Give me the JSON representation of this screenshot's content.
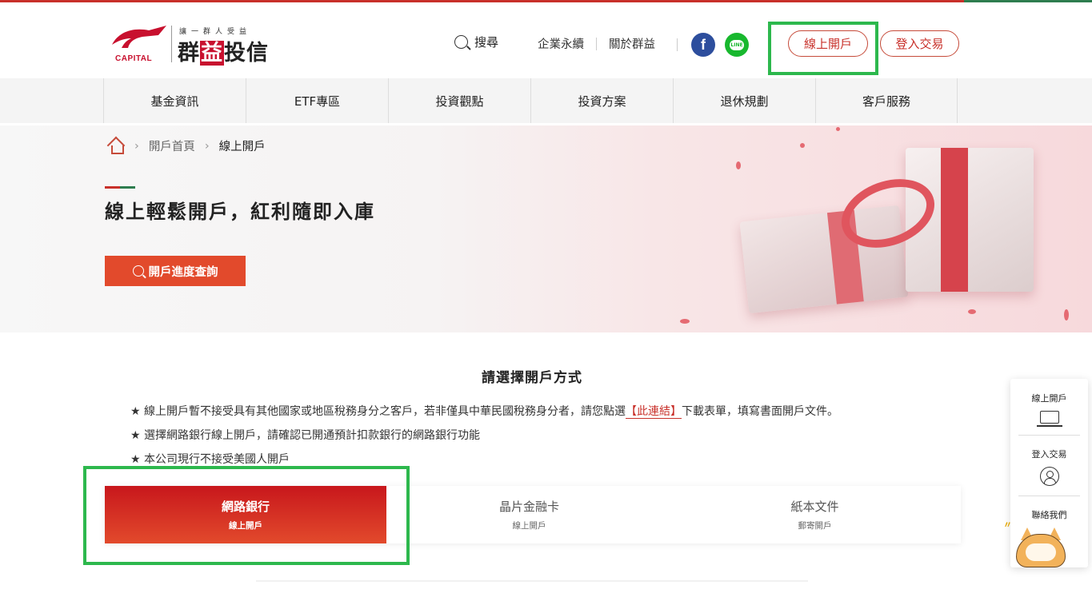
{
  "brand": {
    "logo_text": "CAPITAL",
    "slogan": "讓一群人受益",
    "name_part1": "群",
    "name_part2": "益",
    "name_part3": "投信"
  },
  "header": {
    "search_label": "搜尋",
    "links": [
      "企業永續",
      "關於群益"
    ],
    "facebook_glyph": "f",
    "line_glyph": "LINE",
    "open_account_button": "線上開戶",
    "login_trade_button": "登入交易"
  },
  "nav": {
    "items": [
      "基金資訊",
      "ETF專區",
      "投資觀點",
      "投資方案",
      "退休規劃",
      "客戶服務"
    ]
  },
  "breadcrumb": {
    "items": [
      "開戶首頁",
      "線上開戶"
    ]
  },
  "banner": {
    "headline": "線上輕鬆開戶，紅利隨即入庫",
    "query_button": "開戶進度查詢"
  },
  "section": {
    "title": "請選擇開戶方式",
    "note1_before": "線上開戶暫不接受具有其他國家或地區稅務身分之客戶，若非僅具中華民國稅務身分者，請您點選",
    "note1_link": "【此連結】",
    "note1_after": "下載表單，填寫書面開戶文件。",
    "note2": "選擇網路銀行線上開戶，請確認已開通預計扣款銀行的網路銀行功能",
    "note3": "本公司現行不接受美國人開戶",
    "star": "★"
  },
  "tabs": [
    {
      "title": "網路銀行",
      "subtitle": "線上開戶"
    },
    {
      "title": "晶片金融卡",
      "subtitle": "線上開戶"
    },
    {
      "title": "紙本文件",
      "subtitle": "郵寄開戶"
    }
  ],
  "float_panel": {
    "open_label": "線上開戶",
    "login_label": "登入交易",
    "contact_label": "聯絡我們"
  },
  "colors": {
    "brand_red": "#c8302a",
    "highlight_green": "#2db84d",
    "active_tab": "#c8171c"
  }
}
